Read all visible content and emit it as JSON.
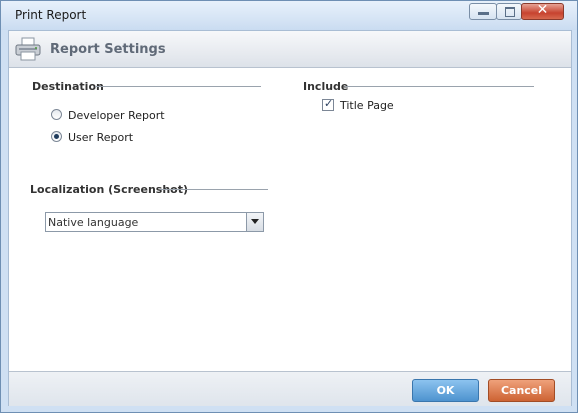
{
  "window": {
    "title": "Print Report",
    "controls": [
      "minimize-icon",
      "maximize-icon",
      "close-icon"
    ]
  },
  "header": {
    "icon": "printer-icon",
    "title": "Report Settings"
  },
  "destination": {
    "label": "Destination",
    "options": [
      {
        "label": "Developer Report",
        "selected": false
      },
      {
        "label": "User Report",
        "selected": true
      }
    ]
  },
  "include": {
    "label": "Include",
    "items": [
      {
        "label": "Title Page",
        "checked": true
      }
    ]
  },
  "localization": {
    "label": "Localization (Screenshot)",
    "selected": "Native language"
  },
  "buttons": {
    "ok": "OK",
    "cancel": "Cancel"
  },
  "colors": {
    "ok_button": "#5a9fd9",
    "cancel_button": "#d9784a",
    "close_button": "#c7432f"
  }
}
